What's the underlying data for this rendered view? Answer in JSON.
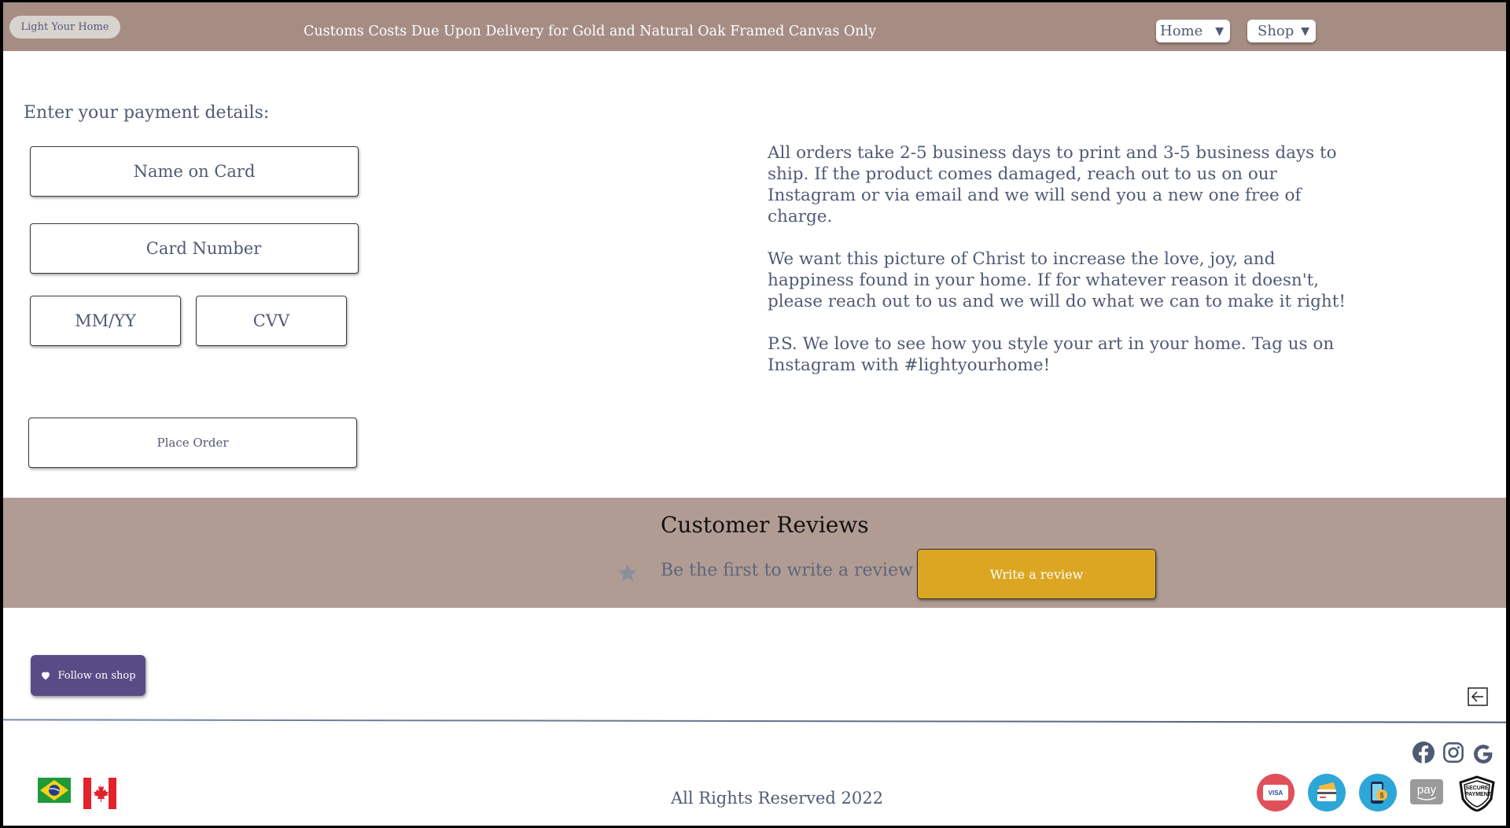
{
  "header": {
    "brand": "Light Your Home",
    "announcement": "Customs Costs Due Upon Delivery for Gold and Natural Oak Framed Canvas Only",
    "nav": [
      {
        "label": "Home",
        "icon": "caret-down-icon"
      },
      {
        "label": "Shop",
        "icon": "caret-down-icon"
      }
    ],
    "colors": {
      "bar": "#a68d84",
      "text": "#ffffff"
    }
  },
  "payment": {
    "title": "Enter your payment details:",
    "name_placeholder": "Name on Card",
    "card_placeholder": "Card Number",
    "expiry_placeholder": "MM/YY",
    "cvv_placeholder": "CVV",
    "submit_label": "Place Order"
  },
  "info": {
    "paragraphs": [
      "All orders take 2-5 business days to print and 3-5 business days to ship. If the product comes damaged, reach out to us on our Instagram or via email and we will send you a new one free of charge.",
      "We want this picture of Christ to increase the love, joy, and happiness found in your home. If for whatever reason it doesn't, please reach out to us and we will do what we can to make it right!",
      "P.S. We love to see how you style your art in your home. Tag us on Instagram with #lightyourhome!"
    ]
  },
  "reviews": {
    "title": "Customer Reviews",
    "empty_text": "Be the first to write a review",
    "write_label": "Write a review",
    "colors": {
      "band": "#b19c93",
      "button": "#dba622"
    }
  },
  "follow": {
    "label": "Follow on shop",
    "icon": "heart-icon",
    "color": "#584c86"
  },
  "footer": {
    "rights": "All Rights Reserved 2022",
    "social_icons": [
      "facebook-icon",
      "instagram-icon",
      "google-icon"
    ],
    "flags": [
      "brazil-flag-icon",
      "canada-flag-icon"
    ],
    "payment_icons": [
      "visa-icon",
      "credit-card-icon",
      "mobile-pay-icon",
      "amazon-pay-icon",
      "secure-payment-icon"
    ],
    "secure_badge_text": "SECURE PAYMENT",
    "amazon_text": "pay",
    "visa_text": "VISA"
  }
}
